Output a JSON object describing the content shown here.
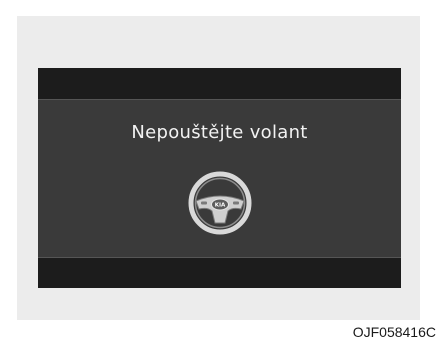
{
  "display": {
    "message": "Nepouštějte volant",
    "icon": "steering-wheel-icon"
  },
  "figure": {
    "code": "OJF058416C"
  }
}
